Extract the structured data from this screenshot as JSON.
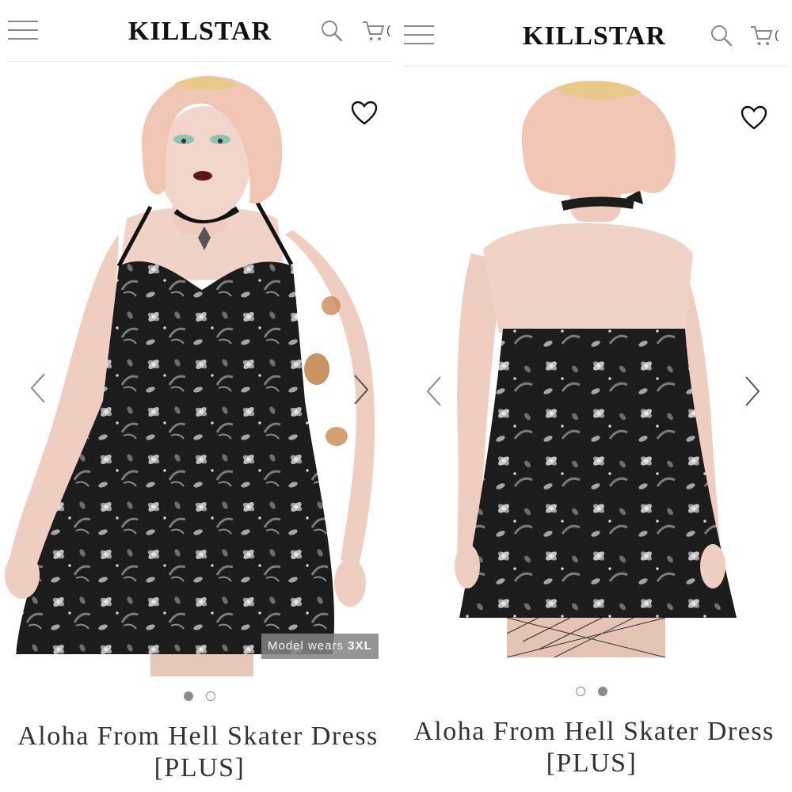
{
  "brand": {
    "logo_text": "KILLSTAR"
  },
  "header": {
    "cart_count": "("
  },
  "product": {
    "title": "Aloha From Hell Skater Dress",
    "subtitle": "[PLUS]",
    "badge_prefix": "Model wears",
    "badge_size": "3XL"
  },
  "gallery": {
    "image_count": 2,
    "left_active_index": 0,
    "right_active_index": 1
  },
  "colors": {
    "dress": "#1b1b1b",
    "skin": "#f0d0c4",
    "hair": "#f2c6b4",
    "text": "#333333"
  }
}
